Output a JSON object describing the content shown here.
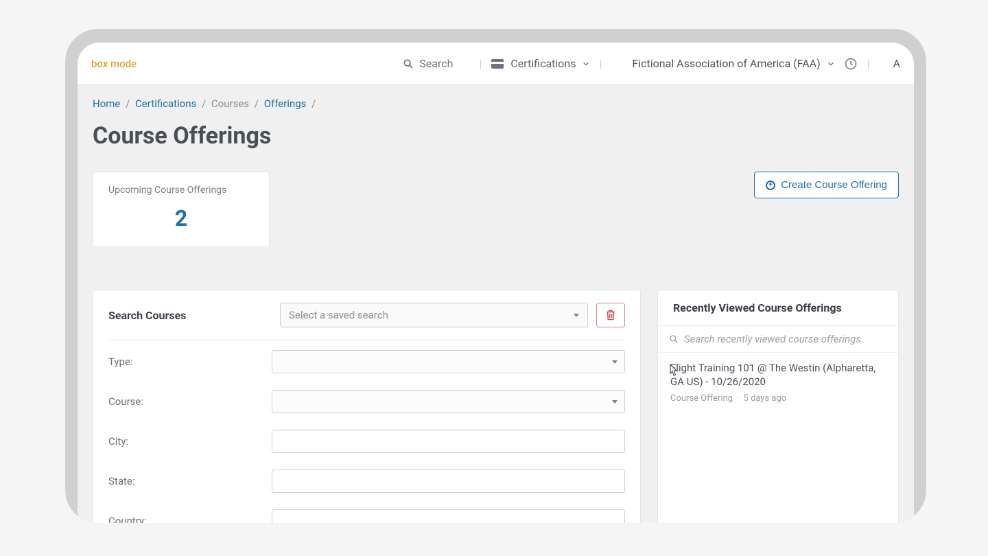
{
  "topbar": {
    "mode_label": "box mode",
    "search_label": "Search",
    "nav_certifications": "Certifications",
    "org_name": "Fictional Association of America (FAA)",
    "avatar_hint": "A"
  },
  "breadcrumb": {
    "home": "Home",
    "certifications": "Certifications",
    "courses": "Courses",
    "offerings": "Offerings"
  },
  "page": {
    "title": "Course Offerings"
  },
  "stats": {
    "upcoming_label": "Upcoming Course Offerings",
    "upcoming_value": "2"
  },
  "actions": {
    "create_label": "Create Course Offering"
  },
  "search_panel": {
    "title": "Search Courses",
    "saved_placeholder": "Select a saved search",
    "fields": {
      "type": "Type:",
      "course": "Course:",
      "city": "City:",
      "state": "State:",
      "country": "Country:"
    }
  },
  "recent_panel": {
    "title": "Recently Viewed Course Offerings",
    "search_placeholder": "Search recently viewed course offerings",
    "items": [
      {
        "title": "Flight Training 101 @ The Westin (Alpharetta, GA US) - 10/26/2020",
        "type": "Course Offering",
        "age": "5 days ago"
      }
    ]
  }
}
